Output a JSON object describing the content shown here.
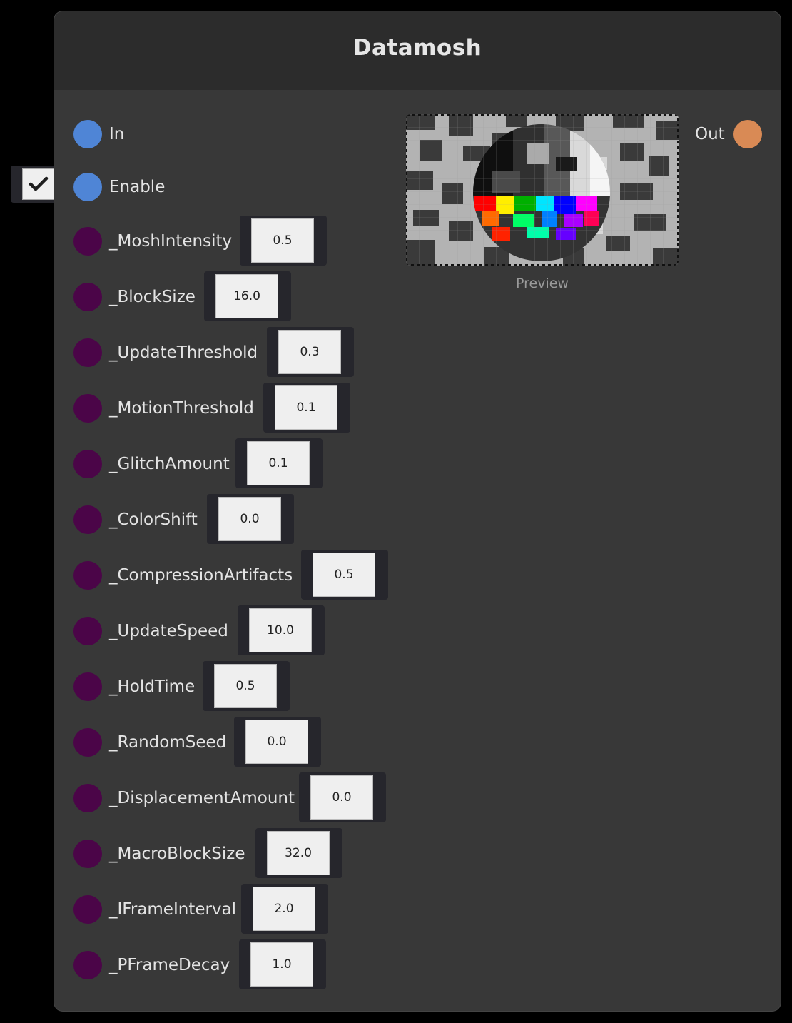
{
  "node": {
    "title": "Datamosh",
    "inputs": {
      "in_label": "In",
      "enable_label": "Enable",
      "enable_checked": true
    },
    "output": {
      "out_label": "Out"
    },
    "preview_label": "Preview",
    "params": [
      {
        "label": "_MoshIntensity",
        "value": "0.5"
      },
      {
        "label": "_BlockSize",
        "value": "16.0"
      },
      {
        "label": "_UpdateThreshold",
        "value": "0.3"
      },
      {
        "label": "_MotionThreshold",
        "value": "0.1"
      },
      {
        "label": "_GlitchAmount",
        "value": "0.1"
      },
      {
        "label": "_ColorShift",
        "value": "0.0"
      },
      {
        "label": "_CompressionArtifacts",
        "value": "0.5"
      },
      {
        "label": "_UpdateSpeed",
        "value": "10.0"
      },
      {
        "label": "_HoldTime",
        "value": "0.5"
      },
      {
        "label": "_RandomSeed",
        "value": "0.0"
      },
      {
        "label": "_DisplacementAmount",
        "value": "0.0"
      },
      {
        "label": "_MacroBlockSize",
        "value": "32.0"
      },
      {
        "label": "_IFrameInterval",
        "value": "2.0"
      },
      {
        "label": "_PFrameDecay",
        "value": "1.0"
      }
    ],
    "colors": {
      "input_port": "#4f85d6",
      "param_port": "#4b0548",
      "output_port": "#d98a55",
      "node_body": "#383838",
      "node_header": "#2c2c2c"
    }
  }
}
